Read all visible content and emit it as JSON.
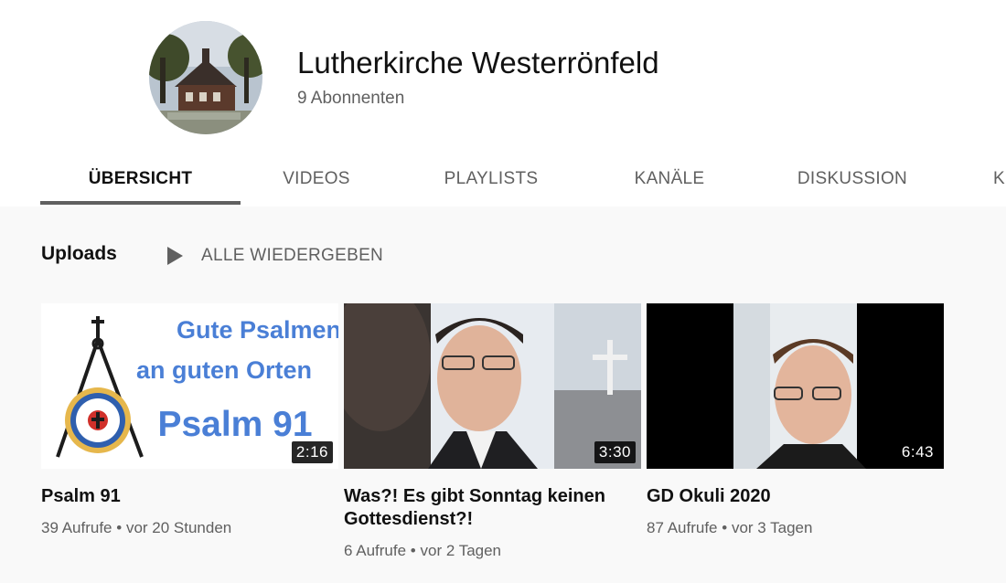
{
  "channel": {
    "name": "Lutherkirche Westerrönfeld",
    "subscribers": "9 Abonnenten"
  },
  "tabs": [
    {
      "label": "ÜBERSICHT",
      "active": true
    },
    {
      "label": "VIDEOS"
    },
    {
      "label": "PLAYLISTS"
    },
    {
      "label": "KANÄLE"
    },
    {
      "label": "DISKUSSION"
    },
    {
      "label": "K"
    }
  ],
  "uploads": {
    "title": "Uploads",
    "play_all": "ALLE WIEDERGEBEN"
  },
  "videos": [
    {
      "thumb_text": [
        "Gute Psalmen",
        "an guten Orten",
        "Psalm 91"
      ],
      "duration": "2:16",
      "title": "Psalm 91",
      "views": "39 Aufrufe",
      "age": "vor 20 Stunden"
    },
    {
      "duration": "3:30",
      "title": "Was?! Es gibt Sonntag keinen Gottesdienst?!",
      "views": "6 Aufrufe",
      "age": "vor 2 Tagen"
    },
    {
      "duration": "6:43",
      "title": "GD Okuli 2020",
      "views": "87 Aufrufe",
      "age": "vor 3 Tagen"
    }
  ],
  "meta_separator": "•",
  "colors": {
    "accent_text": "#4a7fd6",
    "muted": "#606060",
    "header_bg": "#ffffff",
    "page_bg": "#f9f9f9"
  }
}
